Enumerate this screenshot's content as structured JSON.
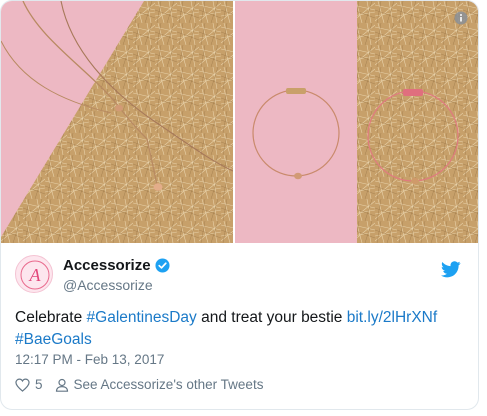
{
  "author": {
    "name": "Accessorize",
    "handle": "@Accessorize"
  },
  "tweet": {
    "text_1": "Celebrate ",
    "hashtag_1": "#GalentinesDay",
    "text_2": " and treat your bestie ",
    "link": "bit.ly/2lHrXNf",
    "hashtag_2": "#BaeGoals",
    "timestamp": "12:17 PM - Feb 13, 2017"
  },
  "actions": {
    "like_count": "5",
    "other_tweets_label": "See Accessorize's other Tweets"
  },
  "icons": {
    "info": "info-icon",
    "verified": "verified-badge-icon",
    "twitter": "twitter-bird-icon",
    "like": "heart-icon",
    "profile": "person-icon"
  },
  "colors": {
    "link": "#1b7ac8",
    "pink": "#eab3be",
    "gold": "#c9a46e",
    "twitter_blue": "#1da1f2",
    "muted": "#657786"
  }
}
